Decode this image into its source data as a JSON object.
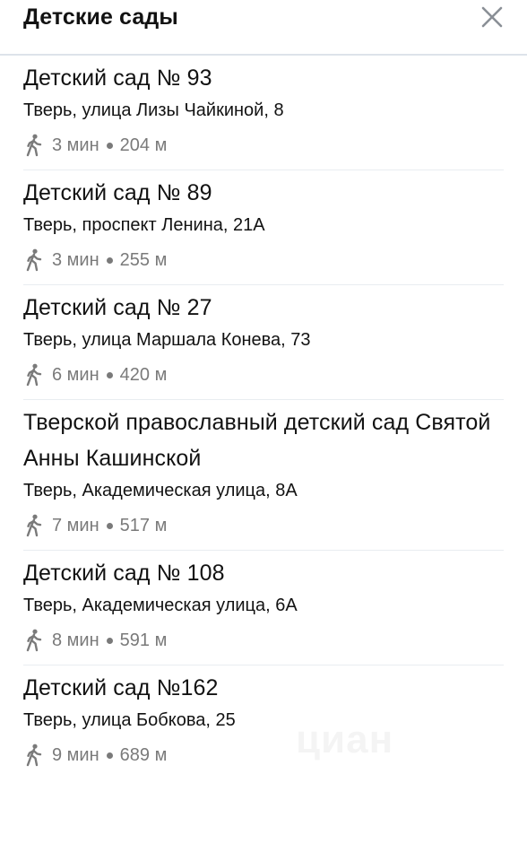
{
  "header": {
    "title": "Детские сады",
    "close_icon": "close-icon"
  },
  "items": [
    {
      "name": "Детский сад № 93",
      "address": "Тверь, улица Лизы Чайкиной, 8",
      "time": "3 мин",
      "distance": "204 м"
    },
    {
      "name": "Детский сад № 89",
      "address": "Тверь, проспект Ленина, 21А",
      "time": "3 мин",
      "distance": "255 м"
    },
    {
      "name": "Детский сад № 27",
      "address": "Тверь, улица Маршала Конева, 73",
      "time": "6 мин",
      "distance": "420 м"
    },
    {
      "name": "Тверской православный детский сад Святой Анны Кашинской",
      "address": "Тверь, Академическая улица, 8А",
      "time": "7 мин",
      "distance": "517 м"
    },
    {
      "name": "Детский сад № 108",
      "address": "Тверь, Академическая улица, 6А",
      "time": "8 мин",
      "distance": "591 м"
    },
    {
      "name": "Детский сад №162",
      "address": "Тверь, улица Бобкова, 25",
      "time": "9 мин",
      "distance": "689 м"
    }
  ],
  "watermark": "циан",
  "icons": {
    "walk": "walking-person-icon",
    "separator": "dot-separator"
  },
  "colors": {
    "text": "#121212",
    "muted": "#7a7a7a",
    "divider": "#e9edf1"
  }
}
